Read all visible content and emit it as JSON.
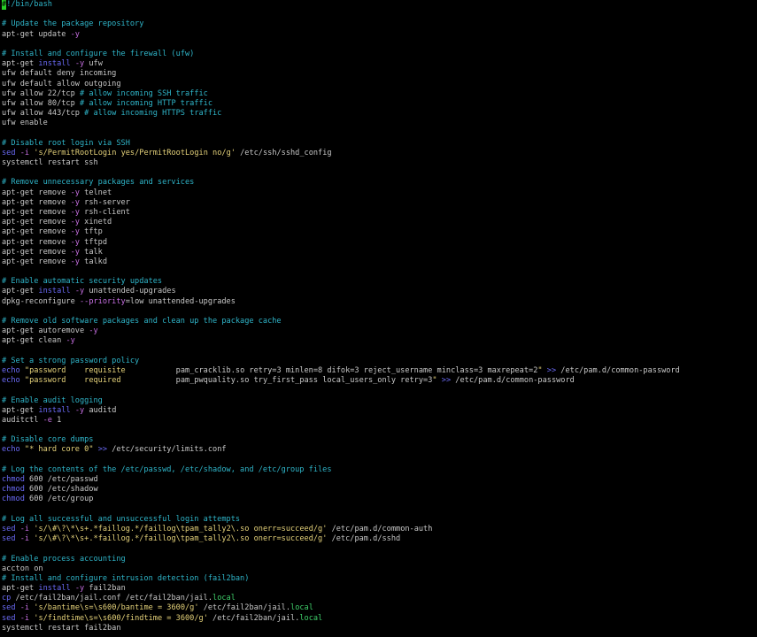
{
  "colors": {
    "background": "#000000",
    "default": "#c8c8c8",
    "comment": "#2fb5c9",
    "keyword": "#6a6af5",
    "flag": "#c56ee0",
    "string": "#e5d27a",
    "path_local": "#3fcf6a",
    "cursor": "#27d127"
  },
  "terminal": {
    "lines": [
      [
        {
          "t": "#",
          "c": "cursor"
        },
        {
          "t": "!/bin/bash",
          "c": "comment"
        }
      ],
      [],
      [
        {
          "t": "# Update the package repository",
          "c": "comment"
        }
      ],
      [
        {
          "t": "apt-get update ",
          "c": "default"
        },
        {
          "t": "-y",
          "c": "flag"
        }
      ],
      [],
      [
        {
          "t": "# Install and configure the firewall (ufw)",
          "c": "comment"
        }
      ],
      [
        {
          "t": "apt-get ",
          "c": "default"
        },
        {
          "t": "install",
          "c": "keyword"
        },
        {
          "t": " ",
          "c": "default"
        },
        {
          "t": "-y",
          "c": "flag"
        },
        {
          "t": " ufw",
          "c": "default"
        }
      ],
      [
        {
          "t": "ufw default deny incoming",
          "c": "default"
        }
      ],
      [
        {
          "t": "ufw default allow outgoing",
          "c": "default"
        }
      ],
      [
        {
          "t": "ufw allow 22/tcp ",
          "c": "default"
        },
        {
          "t": "# allow incoming SSH traffic",
          "c": "comment"
        }
      ],
      [
        {
          "t": "ufw allow 80/tcp ",
          "c": "default"
        },
        {
          "t": "# allow incoming HTTP traffic",
          "c": "comment"
        }
      ],
      [
        {
          "t": "ufw allow 443/tcp ",
          "c": "default"
        },
        {
          "t": "# allow incoming HTTPS traffic",
          "c": "comment"
        }
      ],
      [
        {
          "t": "ufw enable",
          "c": "default"
        }
      ],
      [],
      [
        {
          "t": "# Disable root login via SSH",
          "c": "comment"
        }
      ],
      [
        {
          "t": "sed",
          "c": "keyword"
        },
        {
          "t": " ",
          "c": "default"
        },
        {
          "t": "-i",
          "c": "flag"
        },
        {
          "t": " ",
          "c": "default"
        },
        {
          "t": "'s/PermitRootLogin yes/PermitRootLogin no/g'",
          "c": "string"
        },
        {
          "t": " /etc/ssh/sshd_config",
          "c": "default"
        }
      ],
      [
        {
          "t": "systemctl restart ssh",
          "c": "default"
        }
      ],
      [],
      [
        {
          "t": "# Remove unnecessary packages and services",
          "c": "comment"
        }
      ],
      [
        {
          "t": "apt-get remove ",
          "c": "default"
        },
        {
          "t": "-y",
          "c": "flag"
        },
        {
          "t": " telnet",
          "c": "default"
        }
      ],
      [
        {
          "t": "apt-get remove ",
          "c": "default"
        },
        {
          "t": "-y",
          "c": "flag"
        },
        {
          "t": " rsh-server",
          "c": "default"
        }
      ],
      [
        {
          "t": "apt-get remove ",
          "c": "default"
        },
        {
          "t": "-y",
          "c": "flag"
        },
        {
          "t": " rsh-client",
          "c": "default"
        }
      ],
      [
        {
          "t": "apt-get remove ",
          "c": "default"
        },
        {
          "t": "-y",
          "c": "flag"
        },
        {
          "t": " xinetd",
          "c": "default"
        }
      ],
      [
        {
          "t": "apt-get remove ",
          "c": "default"
        },
        {
          "t": "-y",
          "c": "flag"
        },
        {
          "t": " tftp",
          "c": "default"
        }
      ],
      [
        {
          "t": "apt-get remove ",
          "c": "default"
        },
        {
          "t": "-y",
          "c": "flag"
        },
        {
          "t": " tftpd",
          "c": "default"
        }
      ],
      [
        {
          "t": "apt-get remove ",
          "c": "default"
        },
        {
          "t": "-y",
          "c": "flag"
        },
        {
          "t": " talk",
          "c": "default"
        }
      ],
      [
        {
          "t": "apt-get remove ",
          "c": "default"
        },
        {
          "t": "-y",
          "c": "flag"
        },
        {
          "t": " talkd",
          "c": "default"
        }
      ],
      [],
      [
        {
          "t": "# Enable automatic security updates",
          "c": "comment"
        }
      ],
      [
        {
          "t": "apt-get ",
          "c": "default"
        },
        {
          "t": "install",
          "c": "keyword"
        },
        {
          "t": " ",
          "c": "default"
        },
        {
          "t": "-y",
          "c": "flag"
        },
        {
          "t": " unattended-upgrades",
          "c": "default"
        }
      ],
      [
        {
          "t": "dpkg-reconfigure ",
          "c": "default"
        },
        {
          "t": "--priority",
          "c": "flag"
        },
        {
          "t": "=low unattended-upgrades",
          "c": "default"
        }
      ],
      [],
      [
        {
          "t": "# Remove old software packages and clean up the package cache",
          "c": "comment"
        }
      ],
      [
        {
          "t": "apt-get autoremove ",
          "c": "default"
        },
        {
          "t": "-y",
          "c": "flag"
        }
      ],
      [
        {
          "t": "apt-get clean ",
          "c": "default"
        },
        {
          "t": "-y",
          "c": "flag"
        }
      ],
      [],
      [
        {
          "t": "# Set a strong password policy",
          "c": "comment"
        }
      ],
      [
        {
          "t": "echo",
          "c": "keyword"
        },
        {
          "t": " ",
          "c": "default"
        },
        {
          "t": "\"password    requisite           ",
          "c": "string"
        },
        {
          "t": "pam_cracklib.so retry=3 minlen=8 difok=3 reject_username minclass=3 maxrepeat=2",
          "c": "default"
        },
        {
          "t": "\"",
          "c": "string"
        },
        {
          "t": " ",
          "c": "default"
        },
        {
          "t": ">>",
          "c": "keyword"
        },
        {
          "t": " /etc/pam.d/common-password",
          "c": "default"
        }
      ],
      [
        {
          "t": "echo",
          "c": "keyword"
        },
        {
          "t": " ",
          "c": "default"
        },
        {
          "t": "\"password    required            ",
          "c": "string"
        },
        {
          "t": "pam_pwquality.so try_first_pass local_users_only retry=3",
          "c": "default"
        },
        {
          "t": "\"",
          "c": "string"
        },
        {
          "t": " ",
          "c": "default"
        },
        {
          "t": ">>",
          "c": "keyword"
        },
        {
          "t": " /etc/pam.d/common-password",
          "c": "default"
        }
      ],
      [],
      [
        {
          "t": "# Enable audit logging",
          "c": "comment"
        }
      ],
      [
        {
          "t": "apt-get ",
          "c": "default"
        },
        {
          "t": "install",
          "c": "keyword"
        },
        {
          "t": " ",
          "c": "default"
        },
        {
          "t": "-y",
          "c": "flag"
        },
        {
          "t": " auditd",
          "c": "default"
        }
      ],
      [
        {
          "t": "auditctl ",
          "c": "default"
        },
        {
          "t": "-e",
          "c": "flag"
        },
        {
          "t": " 1",
          "c": "default"
        }
      ],
      [],
      [
        {
          "t": "# Disable core dumps",
          "c": "comment"
        }
      ],
      [
        {
          "t": "echo",
          "c": "keyword"
        },
        {
          "t": " ",
          "c": "default"
        },
        {
          "t": "\"* hard core 0\"",
          "c": "string"
        },
        {
          "t": " ",
          "c": "default"
        },
        {
          "t": ">>",
          "c": "keyword"
        },
        {
          "t": " /etc/security/limits.conf",
          "c": "default"
        }
      ],
      [],
      [
        {
          "t": "# Log the contents of the /etc/passwd, /etc/shadow, and /etc/group files",
          "c": "comment"
        }
      ],
      [
        {
          "t": "chmod",
          "c": "keyword"
        },
        {
          "t": " 600 /etc/passwd",
          "c": "default"
        }
      ],
      [
        {
          "t": "chmod",
          "c": "keyword"
        },
        {
          "t": " 600 /etc/shadow",
          "c": "default"
        }
      ],
      [
        {
          "t": "chmod",
          "c": "keyword"
        },
        {
          "t": " 600 /etc/group",
          "c": "default"
        }
      ],
      [],
      [
        {
          "t": "# Log all successful and unsuccessful login attempts",
          "c": "comment"
        }
      ],
      [
        {
          "t": "sed",
          "c": "keyword"
        },
        {
          "t": " ",
          "c": "default"
        },
        {
          "t": "-i",
          "c": "flag"
        },
        {
          "t": " ",
          "c": "default"
        },
        {
          "t": "'s/\\#\\?\\*\\s+.*faillog.*/faillog\\tpam_tally2\\.so onerr=succeed/g'",
          "c": "string"
        },
        {
          "t": " /etc/pam.d/common-auth",
          "c": "default"
        }
      ],
      [
        {
          "t": "sed",
          "c": "keyword"
        },
        {
          "t": " ",
          "c": "default"
        },
        {
          "t": "-i",
          "c": "flag"
        },
        {
          "t": " ",
          "c": "default"
        },
        {
          "t": "'s/\\#\\?\\*\\s+.*faillog.*/faillog\\tpam_tally2\\.so onerr=succeed/g'",
          "c": "string"
        },
        {
          "t": " /etc/pam.d/sshd",
          "c": "default"
        }
      ],
      [],
      [
        {
          "t": "# Enable process accounting",
          "c": "comment"
        }
      ],
      [
        {
          "t": "accton on",
          "c": "default"
        }
      ],
      [
        {
          "t": "# Install and configure intrusion detection (fail2ban)",
          "c": "comment"
        }
      ],
      [
        {
          "t": "apt-get ",
          "c": "default"
        },
        {
          "t": "install",
          "c": "keyword"
        },
        {
          "t": " ",
          "c": "default"
        },
        {
          "t": "-y",
          "c": "flag"
        },
        {
          "t": " fail2ban",
          "c": "default"
        }
      ],
      [
        {
          "t": "cp",
          "c": "keyword"
        },
        {
          "t": " /etc/fail2ban/jail.conf /etc/fail2ban/jail.",
          "c": "default"
        },
        {
          "t": "local",
          "c": "path_local"
        }
      ],
      [
        {
          "t": "sed",
          "c": "keyword"
        },
        {
          "t": " ",
          "c": "default"
        },
        {
          "t": "-i",
          "c": "flag"
        },
        {
          "t": " ",
          "c": "default"
        },
        {
          "t": "'s/bantime\\s=\\s600/bantime = 3600/g'",
          "c": "string"
        },
        {
          "t": " /etc/fail2ban/jail.",
          "c": "default"
        },
        {
          "t": "local",
          "c": "path_local"
        }
      ],
      [
        {
          "t": "sed",
          "c": "keyword"
        },
        {
          "t": " ",
          "c": "default"
        },
        {
          "t": "-i",
          "c": "flag"
        },
        {
          "t": " ",
          "c": "default"
        },
        {
          "t": "'s/findtime\\s=\\s600/findtime = 3600/g'",
          "c": "string"
        },
        {
          "t": " /etc/fail2ban/jail.",
          "c": "default"
        },
        {
          "t": "local",
          "c": "path_local"
        }
      ],
      [
        {
          "t": "systemctl restart fail2ban",
          "c": "default"
        }
      ]
    ]
  }
}
